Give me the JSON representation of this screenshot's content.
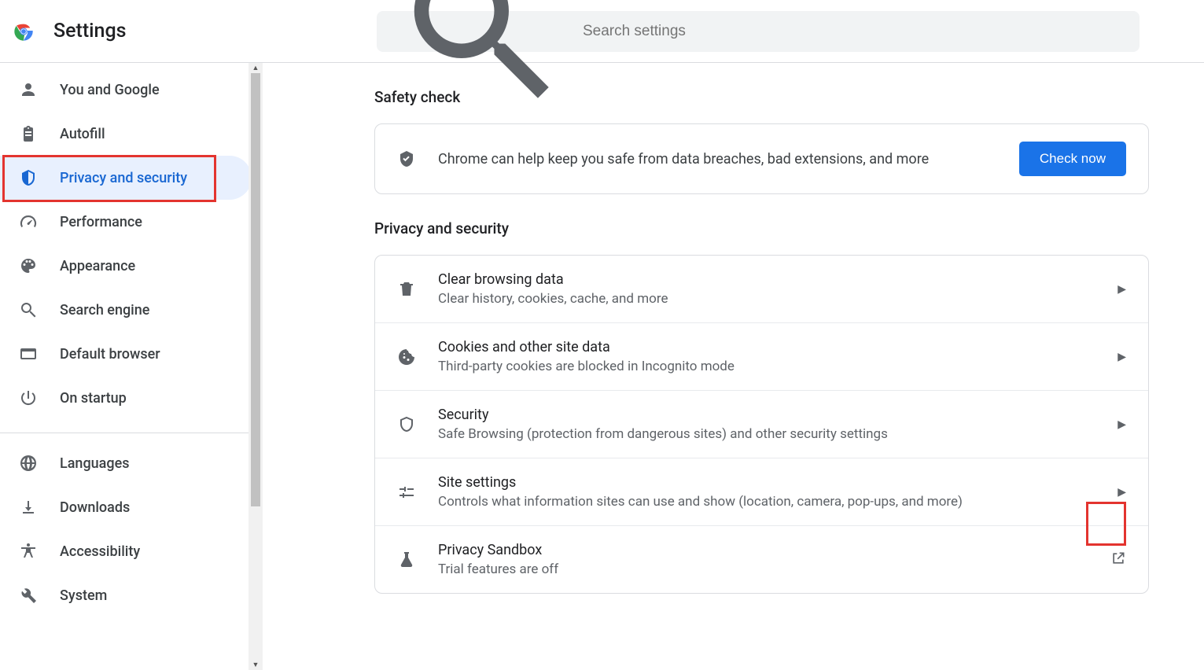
{
  "header": {
    "title": "Settings",
    "search_placeholder": "Search settings"
  },
  "sidebar": {
    "items": [
      {
        "icon": "person-icon",
        "label": "You and Google"
      },
      {
        "icon": "clipboard-icon",
        "label": "Autofill"
      },
      {
        "icon": "shield-icon",
        "label": "Privacy and security",
        "active": true
      },
      {
        "icon": "speedometer-icon",
        "label": "Performance"
      },
      {
        "icon": "palette-icon",
        "label": "Appearance"
      },
      {
        "icon": "magnifier-icon",
        "label": "Search engine"
      },
      {
        "icon": "window-icon",
        "label": "Default browser"
      },
      {
        "icon": "power-icon",
        "label": "On startup"
      }
    ],
    "items2": [
      {
        "icon": "globe-icon",
        "label": "Languages"
      },
      {
        "icon": "download-icon",
        "label": "Downloads"
      },
      {
        "icon": "accessibility-icon",
        "label": "Accessibility"
      },
      {
        "icon": "wrench-icon",
        "label": "System"
      }
    ]
  },
  "main": {
    "safety": {
      "heading": "Safety check",
      "text": "Chrome can help keep you safe from data breaches, bad extensions, and more",
      "button": "Check now"
    },
    "privacy": {
      "heading": "Privacy and security",
      "rows": [
        {
          "icon": "trash-icon",
          "title": "Clear browsing data",
          "sub": "Clear history, cookies, cache, and more",
          "trailing": "arrow"
        },
        {
          "icon": "cookie-icon",
          "title": "Cookies and other site data",
          "sub": "Third-party cookies are blocked in Incognito mode",
          "trailing": "arrow"
        },
        {
          "icon": "shield-outline-icon",
          "title": "Security",
          "sub": "Safe Browsing (protection from dangerous sites) and other security settings",
          "trailing": "arrow"
        },
        {
          "icon": "tune-icon",
          "title": "Site settings",
          "sub": "Controls what information sites can use and show (location, camera, pop-ups, and more)",
          "trailing": "arrow"
        },
        {
          "icon": "flask-icon",
          "title": "Privacy Sandbox",
          "sub": "Trial features are off",
          "trailing": "launch"
        }
      ]
    }
  }
}
